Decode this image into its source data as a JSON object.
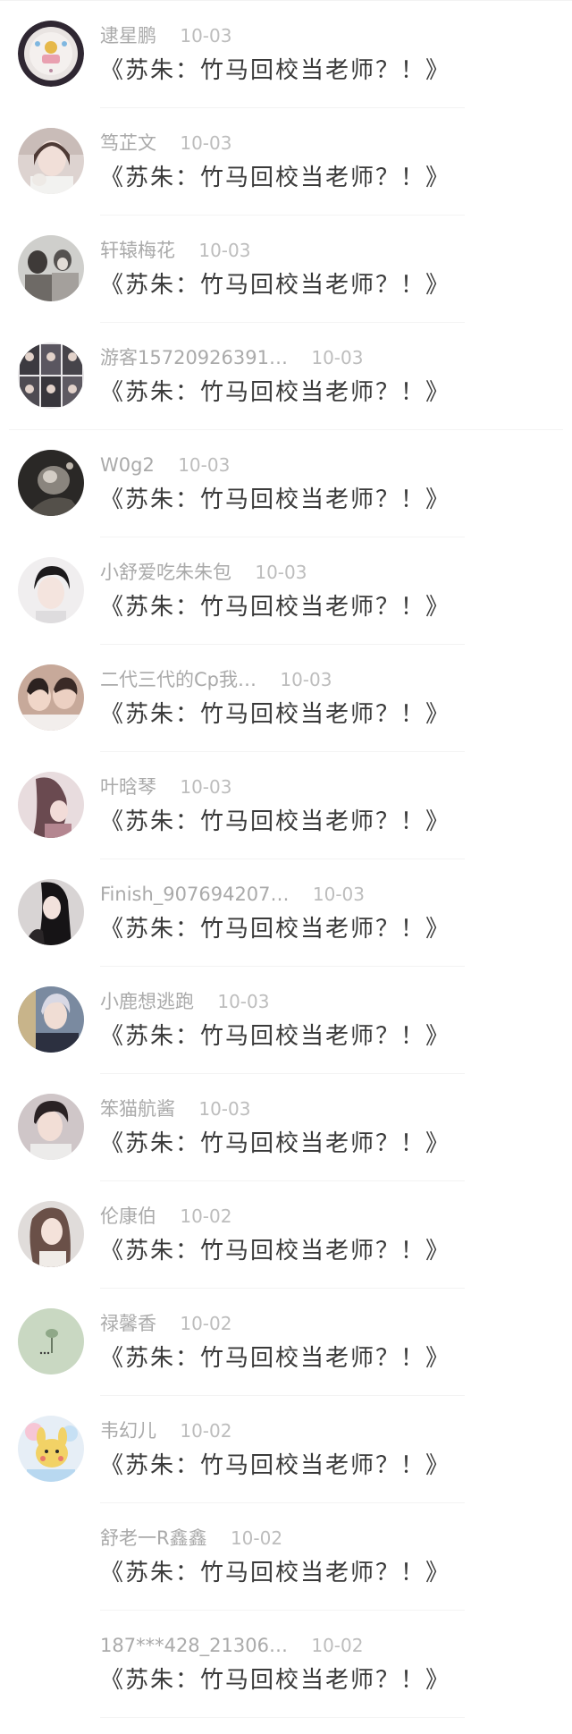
{
  "comments": [
    {
      "username": "逮星鹏",
      "date": "10-03",
      "message": "《苏朱：竹马回校当老师？！》",
      "avatar": "avatar-1",
      "avatar_color": "#3a2f3a"
    },
    {
      "username": "笃芷文",
      "date": "10-03",
      "message": "《苏朱：竹马回校当老师？！》",
      "avatar": "avatar-2",
      "avatar_color": "#d9c9c4"
    },
    {
      "username": "轩辕梅花",
      "date": "10-03",
      "message": "《苏朱：竹马回校当老师？！》",
      "avatar": "avatar-3",
      "avatar_color": "#8a8a88"
    },
    {
      "username": "游客15720926391…",
      "date": "10-03",
      "message": "《苏朱：竹马回校当老师？！》",
      "avatar": "avatar-4",
      "avatar_color": "#4a4a50"
    },
    {
      "username": "W0g2",
      "date": "10-03",
      "message": "《苏朱：竹马回校当老师？！》",
      "avatar": "avatar-5",
      "avatar_color": "#5a5550"
    },
    {
      "username": "小舒爱吃朱朱包",
      "date": "10-03",
      "message": "《苏朱：竹马回校当老师？！》",
      "avatar": "avatar-6",
      "avatar_color": "#e8e4e6"
    },
    {
      "username": "二代三代的Cp我…",
      "date": "10-03",
      "message": "《苏朱：竹马回校当老师？！》",
      "avatar": "avatar-7",
      "avatar_color": "#7a5a4e"
    },
    {
      "username": "叶晗琴",
      "date": "10-03",
      "message": "《苏朱：竹马回校当老师？！》",
      "avatar": "avatar-8",
      "avatar_color": "#b89aa0"
    },
    {
      "username": "Finish_907694207…",
      "date": "10-03",
      "message": "《苏朱：竹马回校当老师？！》",
      "avatar": "avatar-9",
      "avatar_color": "#2e2a2c"
    },
    {
      "username": "小鹿想逃跑",
      "date": "10-03",
      "message": "《苏朱：竹马回校当老师？！》",
      "avatar": "avatar-10",
      "avatar_color": "#5a6a80"
    },
    {
      "username": "笨猫航酱",
      "date": "10-03",
      "message": "《苏朱：竹马回校当老师？！》",
      "avatar": "avatar-11",
      "avatar_color": "#9a8a8e"
    },
    {
      "username": "伦康伯",
      "date": "10-02",
      "message": "《苏朱：竹马回校当老师？！》",
      "avatar": "avatar-12",
      "avatar_color": "#c2b6b0"
    },
    {
      "username": "禄馨香",
      "date": "10-02",
      "message": "《苏朱：竹马回校当老师？！》",
      "avatar": "avatar-13",
      "avatar_color": "#c9d8c0"
    },
    {
      "username": "韦幻儿",
      "date": "10-02",
      "message": "《苏朱：竹马回校当老师？！》",
      "avatar": "avatar-14",
      "avatar_color": "#e4d2b6"
    },
    {
      "username": "舒老一R鑫鑫",
      "date": "10-02",
      "message": "《苏朱：竹马回校当老师？！》",
      "avatar": "",
      "avatar_color": ""
    },
    {
      "username": "187***428_21306…",
      "date": "10-02",
      "message": "《苏朱：竹马回校当老师？！》",
      "avatar": "",
      "avatar_color": ""
    }
  ]
}
